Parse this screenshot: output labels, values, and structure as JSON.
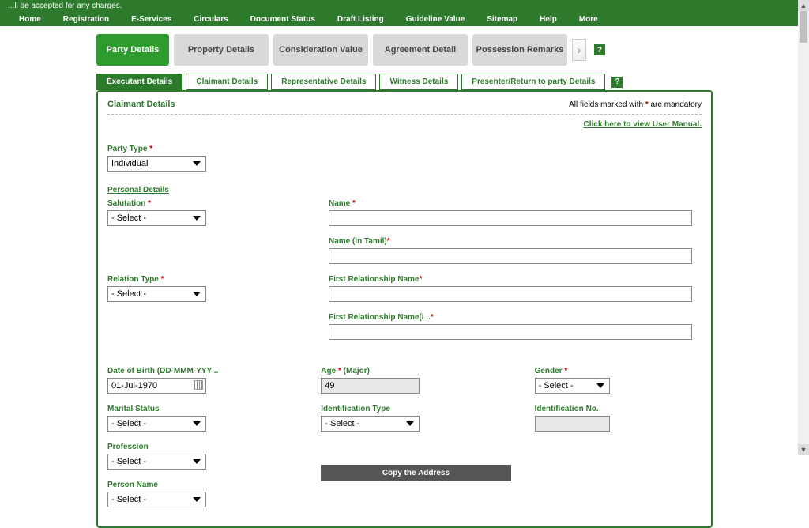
{
  "notice": "...ll be accepted for any charges.",
  "menu": [
    "Home",
    "Registration",
    "E-Services",
    "Circulars",
    "Document Status",
    "Draft Listing",
    "Guideline Value",
    "Sitemap",
    "Help",
    "More"
  ],
  "steps": [
    "Party Details",
    "Property Details",
    "Consideration Value",
    "Agreement Detail",
    "Possession Remarks"
  ],
  "subtabs": [
    "Executant Details",
    "Claimant Details",
    "Representative Details",
    "Witness Details",
    "Presenter/Return to party Details"
  ],
  "panel": {
    "title": "Claimant Details",
    "mandatory_prefix": "All fields marked with ",
    "mandatory_suffix": " are mandatory",
    "user_manual": "Click here to view User Manual.",
    "party_type_label": "Party Type",
    "party_type_value": "Individual",
    "personal_heading": "Personal Details",
    "salutation_label": "Salutation",
    "select_placeholder": "- Select -",
    "name_label": "Name",
    "name_tamil_label": "Name (in Tamil)",
    "relation_type_label": "Relation Type",
    "first_rel_label": "First Relationship Name",
    "first_rel_tamil_label": "First Relationship Name(i ..",
    "dob_label": "Date of Birth (DD-MMM-YYY ..",
    "dob_value": "01-Jul-1970",
    "age_label": "Age",
    "age_suffix": "(Major)",
    "age_value": "49",
    "gender_label": "Gender",
    "marital_label": "Marital Status",
    "idtype_label": "Identification Type",
    "idno_label": "Identification No.",
    "profession_label": "Profession",
    "person_name_label": "Person Name",
    "copy_btn": "Copy the Address"
  }
}
